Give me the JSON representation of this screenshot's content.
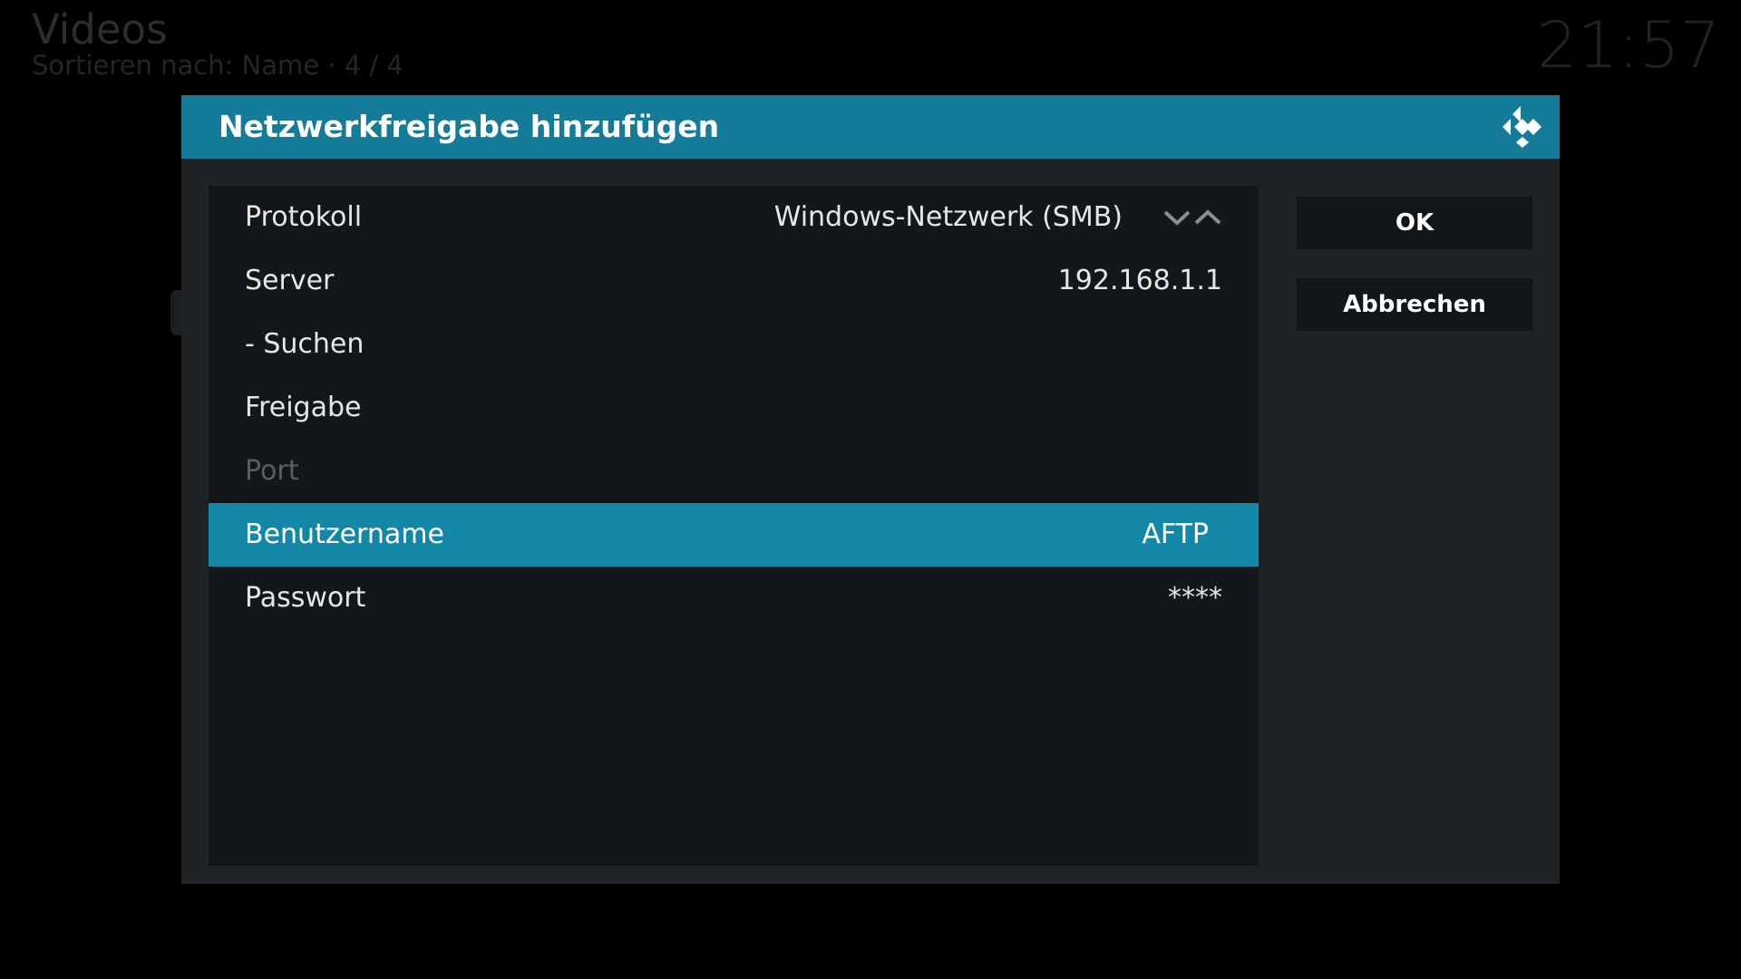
{
  "background": {
    "title": "Videos",
    "subtitle": "Sortieren nach: Name  ·  4 / 4",
    "clock": "21:57"
  },
  "dialog": {
    "title": "Netzwerkfreigabe hinzufügen",
    "logo_icon": "kodi-logo-icon",
    "rows": [
      {
        "label": "Protokoll",
        "value": "Windows-Netzwerk (SMB)"
      },
      {
        "label": "Server",
        "value": "192.168.1.1"
      },
      {
        "label": "- Suchen",
        "value": ""
      },
      {
        "label": "Freigabe",
        "value": ""
      },
      {
        "label": "Port",
        "value": ""
      },
      {
        "label": "Benutzername",
        "value": "AFTP"
      },
      {
        "label": "Passwort",
        "value": "****"
      }
    ],
    "buttons": {
      "ok": "OK",
      "cancel": "Abbrechen"
    }
  },
  "colors": {
    "accent": "#147b98",
    "selected": "#1287a8",
    "dialog_bg": "#1f2326",
    "panel_bg": "#13171a"
  }
}
